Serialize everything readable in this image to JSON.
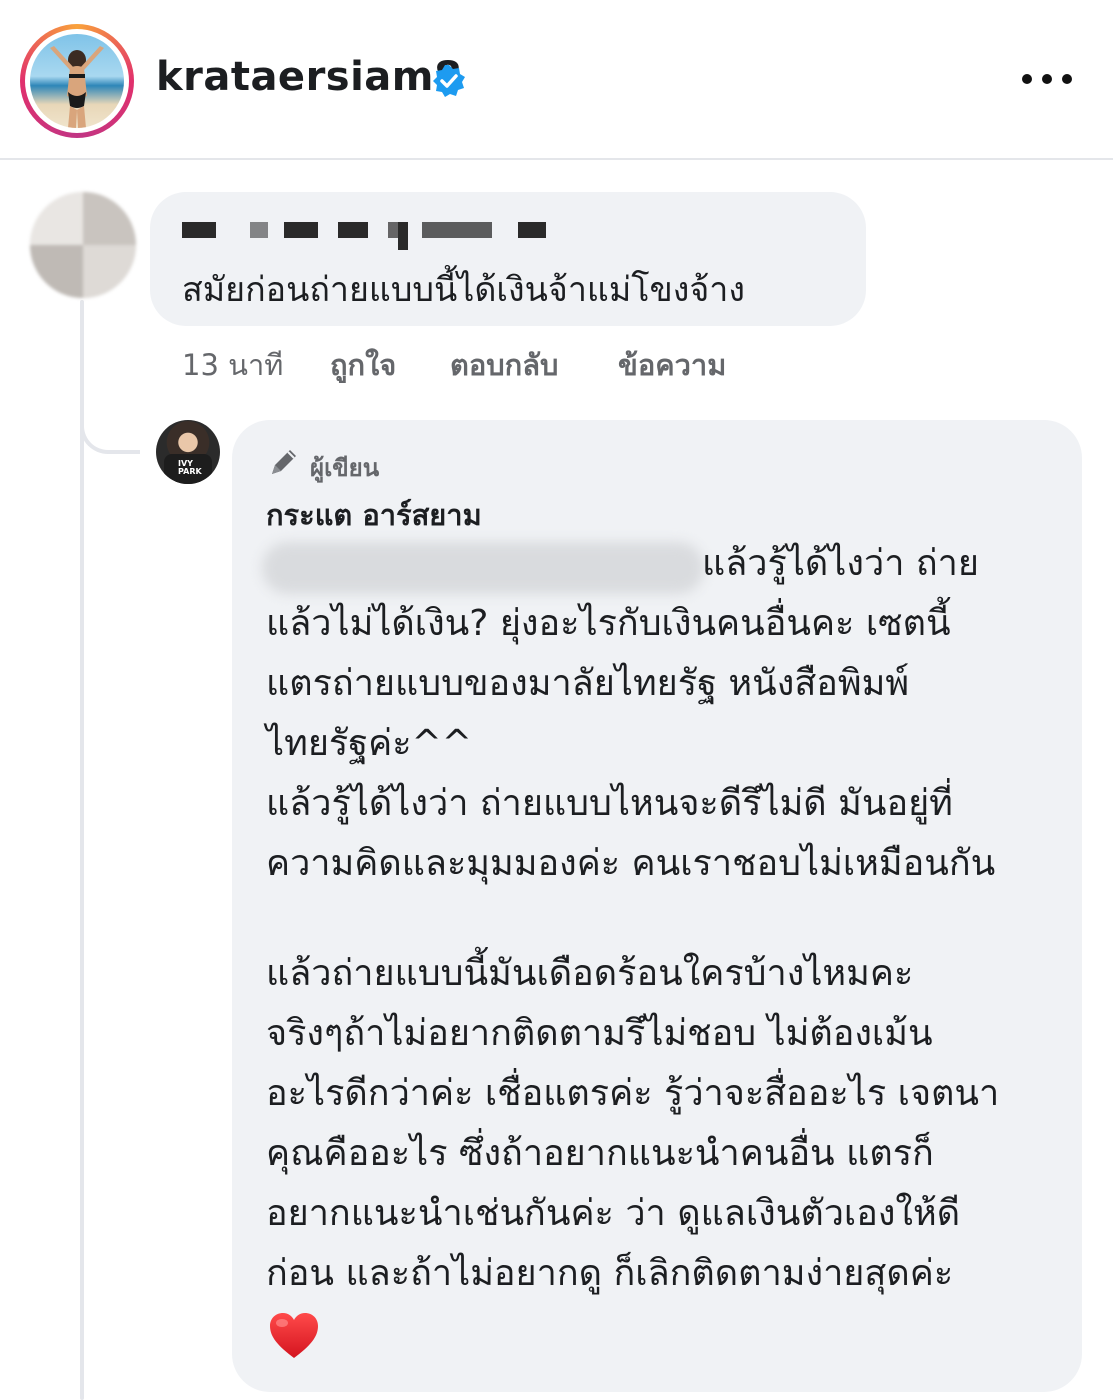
{
  "header": {
    "username": "krataersiam8",
    "verified_icon": "verified-badge-icon",
    "more_icon": "more-dots-icon"
  },
  "comment": {
    "text": "สมัยก่อนถ่ายแบบนี้ได้เงินจ้าแม่โขงจ้าง",
    "time": "13 นาที",
    "like_label": "ถูกใจ",
    "reply_label": "ตอบกลับ",
    "message_label": "ข้อความ"
  },
  "reply": {
    "author_badge": "ผู้เขียน",
    "name": "กระแต อาร์สยาม",
    "lines": [
      "แล้วรู้ได้ไงว่า ถ่าย",
      "แล้วไม่ได้เงิน? ยุ่งอะไรกับเงินคนอื่นคะ เซตนี้",
      "แตรถ่ายแบบของมาลัยไทยรัฐ หนังสือพิมพ์",
      "ไทยรัฐค่ะ^^",
      "แล้วรู้ได้ไงว่า ถ่ายแบบไหนจะดีรึไม่ดี  มันอยู่ที่",
      "ความคิดและมุมมองค่ะ คนเราชอบไม่เหมือนกัน",
      "แล้วถ่ายแบบนี้มันเดือดร้อนใครบ้างไหมคะ",
      "จริงๆถ้าไม่อยากติดตามรึไม่ชอบ ไม่ต้องเม้น",
      "อะไรดีกว่าค่ะ เชื่อแตรค่ะ รู้ว่าจะสื่ออะไร เจตนา",
      "คุณคืออะไร ซึ่งถ้าอยากแนะนำคนอื่น แตรก็",
      "อยากแนะนำเช่นกันค่ะ ว่า ดูแลเงินตัวเองให้ดี",
      "ก่อน และถ้าไม่อยากดู ก็เลิกติดตามง่ายสุดค่ะ"
    ],
    "emoji": "heart-emoji-icon"
  },
  "colors": {
    "bubble": "#f0f2f5",
    "secondary_text": "#65676b",
    "verified": "#1d9bf0",
    "heart": "#e0242e"
  }
}
